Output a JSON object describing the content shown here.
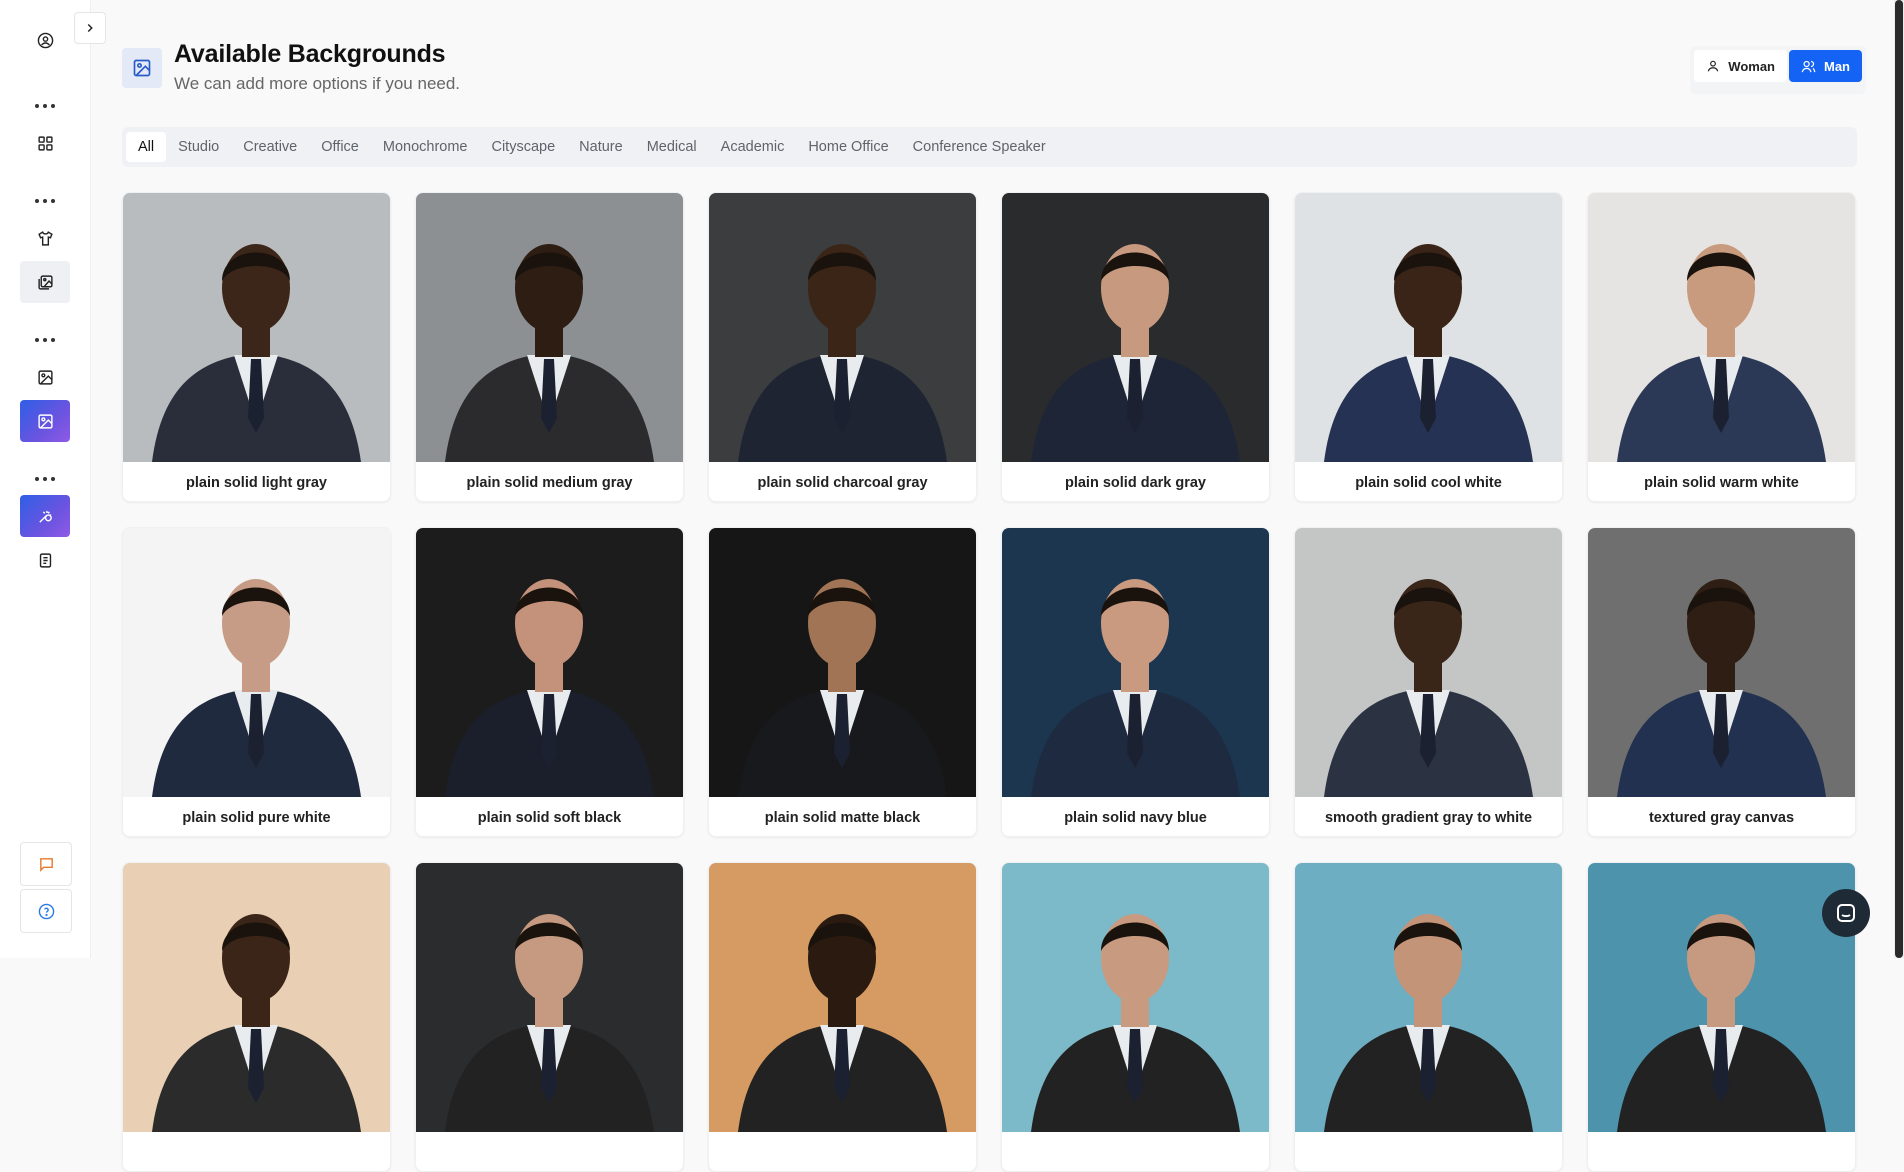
{
  "header": {
    "title": "Available Backgrounds",
    "subtitle": "We can add more options if you need.",
    "gender_options": [
      "Woman",
      "Man"
    ],
    "selected_gender": "Man"
  },
  "tabs": [
    "All",
    "Studio",
    "Creative",
    "Office",
    "Monochrome",
    "Cityscape",
    "Nature",
    "Medical",
    "Academic",
    "Home Office",
    "Conference Speaker"
  ],
  "active_tab": "All",
  "cards": [
    {
      "label": "plain solid light gray",
      "bg": "#b9bcbe",
      "skin": "#3b2619",
      "suit": "#2a2e3a"
    },
    {
      "label": "plain solid medium gray",
      "bg": "#8c9092",
      "skin": "#2e1d13",
      "suit": "#2b2b2d"
    },
    {
      "label": "plain solid charcoal gray",
      "bg": "#3b3d3f",
      "skin": "#3a2517",
      "suit": "#1e2432"
    },
    {
      "label": "plain solid dark gray",
      "bg": "#2a2b2c",
      "skin": "#c79a80",
      "suit": "#1d2536"
    },
    {
      "label": "plain solid cool white",
      "bg": "#dfe2e4",
      "skin": "#3a2418",
      "suit": "#253253"
    },
    {
      "label": "plain solid warm white",
      "bg": "#e6e4e2",
      "skin": "#c89a7e",
      "suit": "#2b3856"
    },
    {
      "label": "plain solid pure white",
      "bg": "#f4f4f4",
      "skin": "#c69c86",
      "suit": "#1f2a3f"
    },
    {
      "label": "plain solid soft black",
      "bg": "#1c1c1c",
      "skin": "#c4917a",
      "suit": "#1a1f2b"
    },
    {
      "label": "plain solid matte black",
      "bg": "#161616",
      "skin": "#a07455",
      "suit": "#18191c"
    },
    {
      "label": "plain solid navy blue",
      "bg": "#1c3650",
      "skin": "#c99a80",
      "suit": "#1e2a40"
    },
    {
      "label": "smooth gradient gray to white",
      "bg": "#c4c6c6",
      "skin": "#3a2519",
      "suit": "#2b3242"
    },
    {
      "label": "textured gray canvas",
      "bg": "#6e6f6e",
      "skin": "#2e1e14",
      "suit": "#233150"
    },
    {
      "label": "",
      "bg": "#e9cfb3",
      "skin": "#3a2518",
      "suit": "#2b2b2b"
    },
    {
      "label": "",
      "bg": "#2a2c2d",
      "skin": "#c59a80",
      "suit": "#222"
    },
    {
      "label": "",
      "bg": "#d59b62",
      "skin": "#2b1a10",
      "suit": "#222"
    },
    {
      "label": "",
      "bg": "#7cb9c9",
      "skin": "#c89a80",
      "suit": "#222"
    },
    {
      "label": "",
      "bg": "#6eaec2",
      "skin": "#c49478",
      "suit": "#222"
    },
    {
      "label": "",
      "bg": "#4d93ab",
      "skin": "#c69a80",
      "suit": "#222"
    }
  ],
  "colors": {
    "accent": "#1463f5",
    "sidebar_active_gradient": [
      "#2f5fe6",
      "#8f5ae6"
    ],
    "page_bg": "#f9f9f9"
  },
  "sidebar_icons": [
    "user-circle-icon",
    "grid-icon",
    "shirt-icon",
    "gallery-icon",
    "image-icon",
    "image-edit-icon",
    "magic-icon",
    "document-icon",
    "message-icon",
    "help-icon"
  ]
}
